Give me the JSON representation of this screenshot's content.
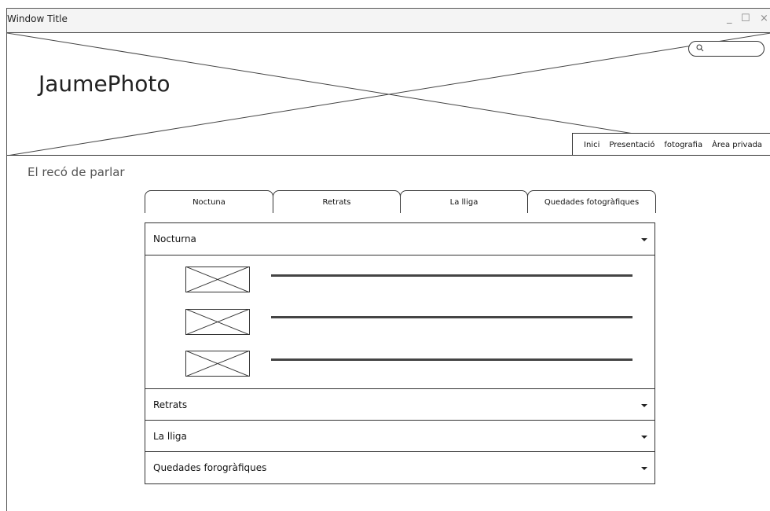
{
  "window": {
    "title": "Window Title",
    "controls": {
      "minimize": "_",
      "maximize": "☐",
      "close": "×"
    }
  },
  "header": {
    "site_title": "JaumePhoto",
    "search": {
      "icon": "search-icon",
      "placeholder": ""
    }
  },
  "nav": {
    "items": [
      "Inici",
      "Presentació",
      "fotografia",
      "Àrea privada"
    ]
  },
  "section": {
    "title": "El recó de parlar"
  },
  "tabs": [
    "Noctuna",
    "Retrats",
    "La lliga",
    "Quedades fotogràfiques"
  ],
  "accordion": [
    {
      "label": "Nocturna",
      "expanded": true
    },
    {
      "label": "Retrats",
      "expanded": false
    },
    {
      "label": "La lliga",
      "expanded": false
    },
    {
      "label": "Quedades forogràfiques",
      "expanded": false
    }
  ]
}
